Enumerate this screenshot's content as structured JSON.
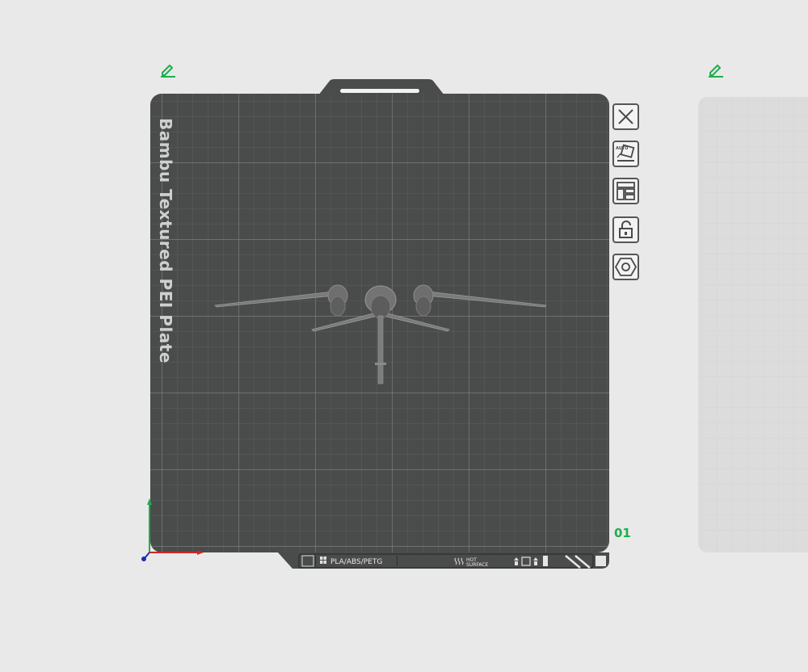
{
  "plate": {
    "name": "Bambu Textured PEI Plate",
    "index": "01",
    "filament_label": "PLA/ABS/PETG",
    "hot_surface_line1": "HOT",
    "hot_surface_line2": "SURFACE"
  },
  "toolbar": {
    "items": [
      {
        "name": "remove-plate",
        "icon": "close-icon"
      },
      {
        "name": "auto-orient",
        "icon": "auto-orient-icon",
        "badge": "AUTO"
      },
      {
        "name": "arrange",
        "icon": "arrange-icon"
      },
      {
        "name": "lock-plate",
        "icon": "unlock-icon"
      },
      {
        "name": "plate-settings",
        "icon": "hex-nut-icon"
      }
    ]
  },
  "colors": {
    "background": "#e9e9e9",
    "plate": "#4a4b4b",
    "grid_line": "#6d6e6e",
    "accent_green": "#1fae4b",
    "axis_x": "#d42424",
    "axis_y": "#1fae4b",
    "axis_z": "#1a2fb0"
  }
}
